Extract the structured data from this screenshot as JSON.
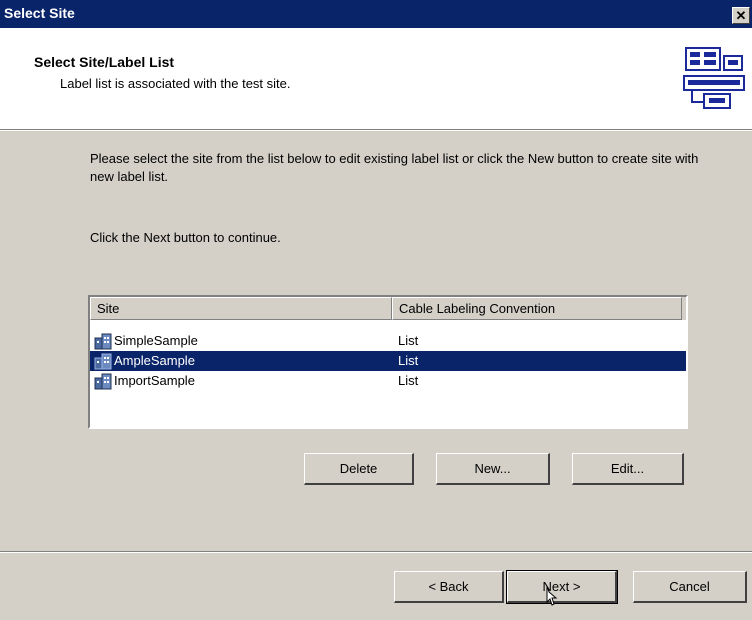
{
  "window": {
    "title": "Select Site",
    "close_glyph": "✕"
  },
  "header": {
    "title": "Select Site/Label List",
    "subtitle": "Label list is associated with the test site.",
    "logo_icon": "label-list-icon"
  },
  "instructions": {
    "line1": "Please select the site from the list below to edit existing label list or click the New button to create site with new label list.",
    "line2": "Click the Next button to continue."
  },
  "site_list": {
    "columns": [
      "Site",
      "Cable Labeling Convention"
    ],
    "rows": [
      {
        "name": "SimpleSample",
        "convention": "List",
        "selected": false
      },
      {
        "name": "AmpleSample",
        "convention": "List",
        "selected": true
      },
      {
        "name": "ImportSample",
        "convention": "List",
        "selected": false
      }
    ],
    "row_icon": "site-building-icon"
  },
  "actions": {
    "delete": "Delete",
    "new": "New...",
    "edit": "Edit..."
  },
  "footer": {
    "back": "< Back",
    "next": "Next >",
    "cancel": "Cancel"
  },
  "colors": {
    "title_bar": "#0a246a",
    "selection": "#0a246a",
    "dialog_face": "#d4d0c8"
  }
}
